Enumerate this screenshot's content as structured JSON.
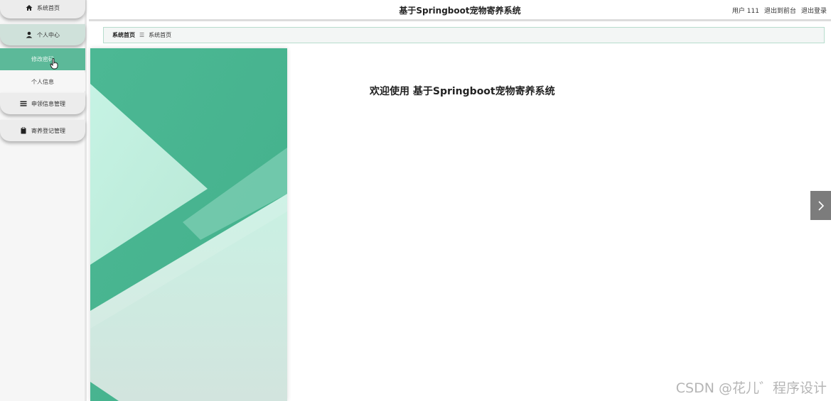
{
  "header": {
    "title": "基于Springboot宠物寄养系统",
    "user_label": "用户 111",
    "back_label": "退出到前台",
    "logout_label": "退出登录"
  },
  "sidebar": {
    "items": [
      {
        "label": "系统首页",
        "icon": "home-icon"
      },
      {
        "label": "个人中心",
        "icon": "user-icon"
      },
      {
        "label": "申领信息管理",
        "icon": "list-icon"
      },
      {
        "label": "寄养登记管理",
        "icon": "clipboard-icon"
      }
    ],
    "submenu": [
      {
        "label": "修改密码"
      },
      {
        "label": "个人信息"
      }
    ]
  },
  "breadcrumb": {
    "first": "系统首页",
    "separator": "☰",
    "current": "系统首页"
  },
  "main": {
    "welcome": "欢迎使用 基于Springboot宠物寄养系统"
  },
  "watermark": "CSDN @花儿゛程序设计",
  "colors": {
    "accent": "#4cb894",
    "accent_light": "#c6f3e4",
    "sidebar_active": "#5cb999"
  }
}
